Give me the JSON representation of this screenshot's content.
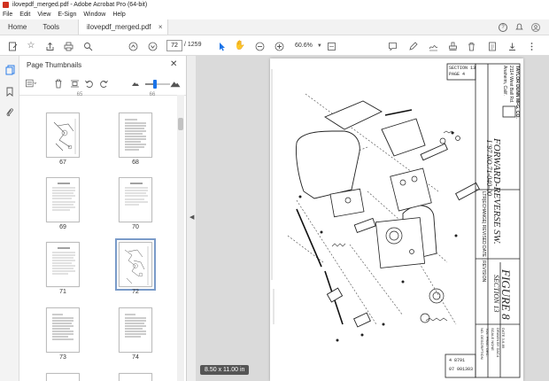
{
  "window": {
    "title": "ilovepdf_merged.pdf - Adobe Acrobat Pro (64-bit)"
  },
  "menu": [
    "File",
    "Edit",
    "View",
    "E-Sign",
    "Window",
    "Help"
  ],
  "tabs": {
    "home": "Home",
    "tools": "Tools",
    "document": "ilovepdf_merged.pdf"
  },
  "toolbar": {
    "current_page": "72",
    "page_total": "/ 1259",
    "zoom": "60.6%"
  },
  "thumbnails_panel": {
    "title": "Page Thumbnails",
    "top_partial_labels": [
      "65",
      "66"
    ],
    "pages": [
      {
        "label": "67"
      },
      {
        "label": "68"
      },
      {
        "label": "69"
      },
      {
        "label": "70"
      },
      {
        "label": "71"
      },
      {
        "label": "72",
        "selected": true
      },
      {
        "label": "73"
      },
      {
        "label": "74"
      }
    ]
  },
  "document_page": {
    "size_badge": "8.50 x 11.00 in",
    "section_box": [
      "SECTION 13",
      "PAGE 4"
    ],
    "company": [
      "TAYLOR DUNN MFG. CO.",
      "2114 West Ball Rd.",
      "Anaheim, Calif."
    ],
    "drawing_title": "FORWARD-REVERSE SW.",
    "drawing_number": "I '97 NO.71-040-00",
    "figure": "FIGURE 8",
    "figure_section": "SECTION 13",
    "header_strip": "LTR|ECHANGE| REVISED DATE | REVISION",
    "bottom_codes": [
      "4 8791",
      "07 001303"
    ],
    "title_block": [
      "NO. DESCRIPTION",
      "TOL. FRAC. DEC.",
      "SCALE NONE",
      "DRAWN BY DAC4",
      "DATE 3-6-89"
    ]
  },
  "accent": "#1a73e8"
}
